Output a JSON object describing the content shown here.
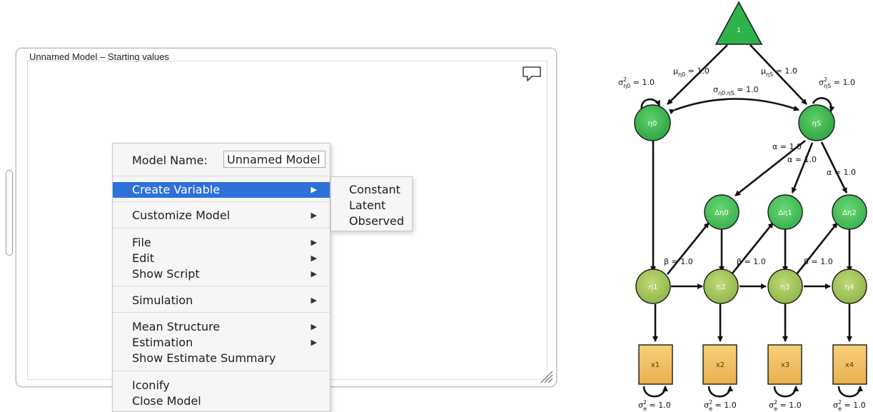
{
  "model_window": {
    "title": "Unnamed Model – Starting values"
  },
  "context_menu": {
    "model_name_label": "Model Name:",
    "model_name_value": "Unnamed Model",
    "items": {
      "create_variable": "Create Variable",
      "customize_model": "Customize Model",
      "file": "File",
      "edit": "Edit",
      "show_script": "Show Script",
      "simulation": "Simulation",
      "mean_structure": "Mean Structure",
      "estimation": "Estimation",
      "show_estimate_summary": "Show Estimate Summary",
      "iconify": "Iconify",
      "close_model": "Close Model"
    },
    "submenu_arrow": "▶"
  },
  "submenu": {
    "items": [
      "Constant",
      "Latent",
      "Observed"
    ]
  },
  "diagram": {
    "constant_label": "1",
    "nodes": {
      "eta0": "η0",
      "etaS": "ηS",
      "d_eta0": "Δη0",
      "d_eta1": "Δη1",
      "d_eta2": "Δη2",
      "eta1": "η1",
      "eta2": "η2",
      "eta3": "η3",
      "eta4": "η4",
      "x1": "x1",
      "x2": "x2",
      "x3": "x3",
      "x4": "x4"
    },
    "labels": {
      "mu_eta0": "μ",
      "mu_eta0_sub": "η0",
      "mu_eta0_val": " = 1.0",
      "mu_etaS": "μ",
      "mu_etaS_sub": "ηS",
      "mu_etaS_val": " = 1.0",
      "var_eta0": "σ",
      "var_eta0_sup": "2",
      "var_eta0_sub": "η0",
      "var_eta0_val": " = 1.0",
      "var_etaS": "σ",
      "var_etaS_sup": "2",
      "var_etaS_sub": "ηS",
      "var_etaS_val": " = 1.0",
      "cov": "σ",
      "cov_sub": "η0.ηS",
      "cov_val": " = 1.0",
      "alpha": "α = 1.0",
      "beta": "β = 1.0",
      "var_e": "σ",
      "var_e_sup": "2",
      "var_e_sub": "e",
      "var_e_val": " = 1.0"
    },
    "colors": {
      "constant": "#2db34a",
      "latent_top": "#3fbb4f",
      "delta": "#4cc45a",
      "eta_row": "#a6c85a",
      "observed": "#f2c063",
      "selection": "#2d71d9"
    }
  }
}
